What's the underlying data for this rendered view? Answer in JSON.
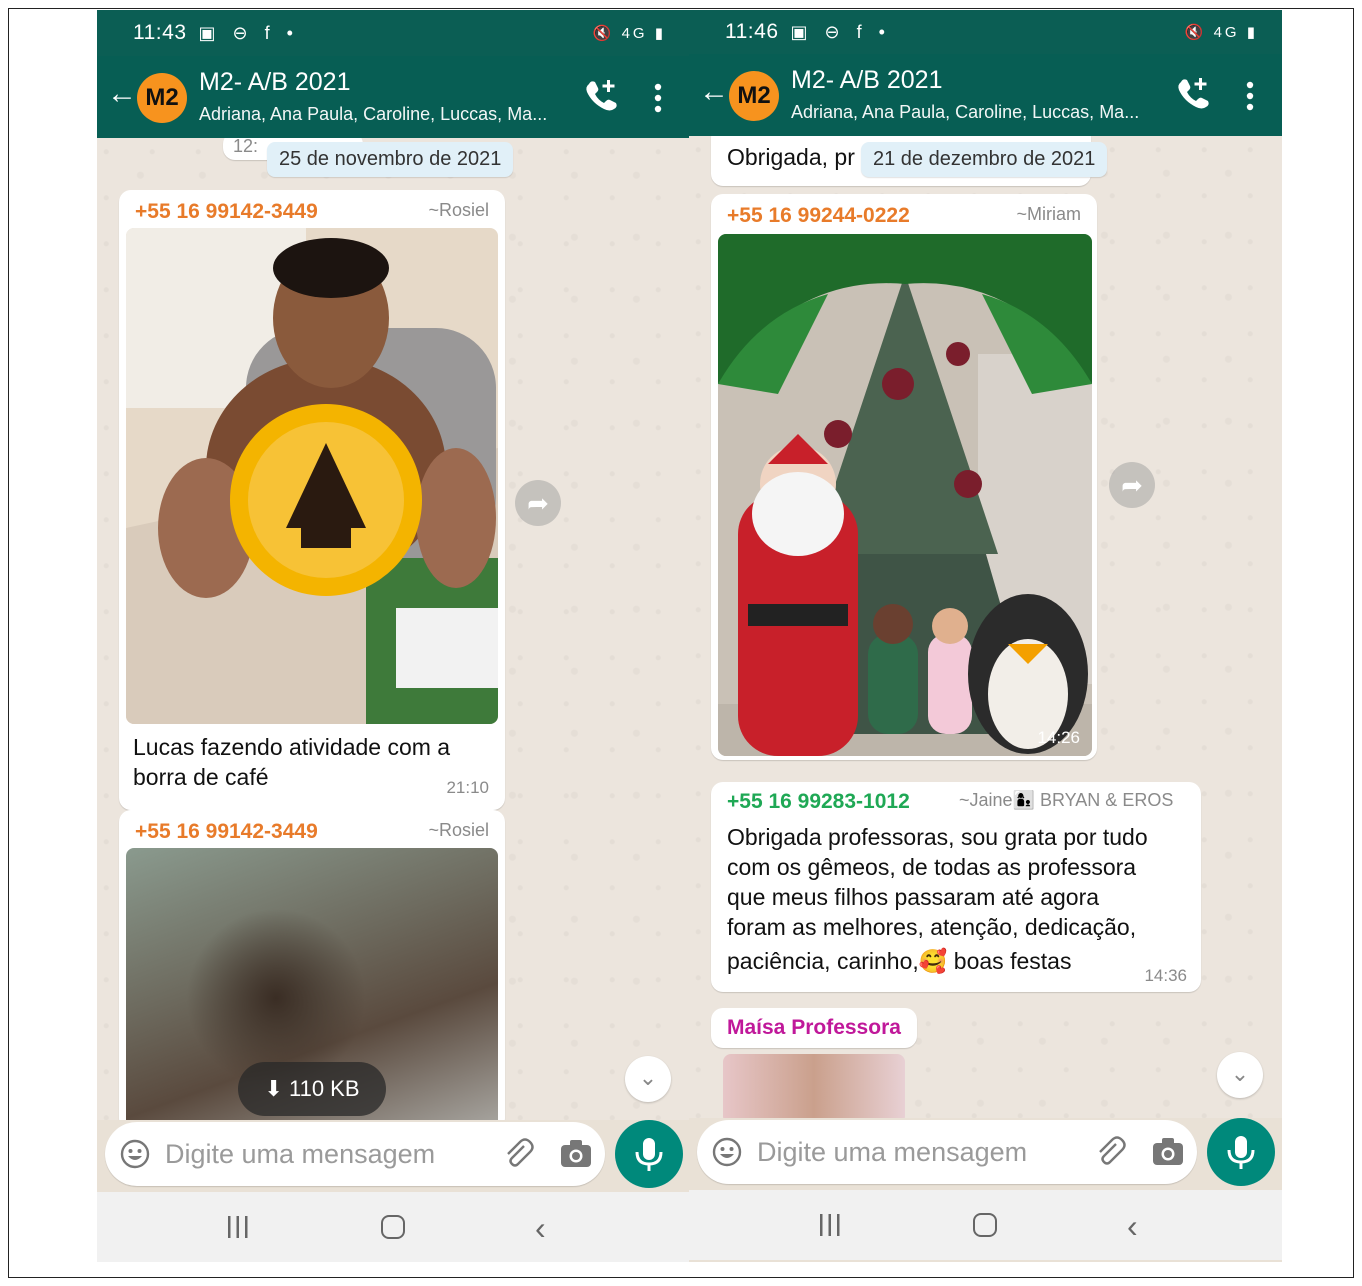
{
  "left": {
    "status": {
      "time": "11:43",
      "icons": "▣ ⊖ f •",
      "right_icons": "🔇 4G ▮"
    },
    "header": {
      "avatar_text": "M2",
      "title": "M2- A/B 2021",
      "subtitle": "Adriana, Ana Paula, Caroline, Luccas, Ma..."
    },
    "partial_time": "12:",
    "date_chip": "25 de novembro de 2021",
    "messages": [
      {
        "phone": "+55 16 99142-3449",
        "name": "~Rosiel",
        "text_line1": "Lucas fazendo atividade com a",
        "text_line2": "borra de café",
        "time": "21:10"
      },
      {
        "phone": "+55 16 99142-3449",
        "name": "~Rosiel",
        "download": "110 KB"
      }
    ],
    "composer": {
      "placeholder": "Digite uma mensagem"
    }
  },
  "right": {
    "status": {
      "time": "11:46",
      "icons": "▣ ⊖ f •",
      "right_icons": "🔇 4G ▮"
    },
    "header": {
      "avatar_text": "M2",
      "title": "M2- A/B 2021",
      "subtitle": "Adriana, Ana Paula, Caroline, Luccas, Ma..."
    },
    "partial_text": "Obrigada, pr",
    "date_chip": "21 de dezembro de 2021",
    "messages": [
      {
        "phone": "+55 16 99244-0222",
        "name": "~Miriam",
        "photo_time": "14:26"
      },
      {
        "phone": "+55 16 99283-1012",
        "name": "~Jaine👩‍👦 BRYAN & EROS",
        "lines": [
          "Obrigada professoras, sou grata por tudo",
          "com os gêmeos, de todas as professora",
          "que meus filhos passaram até agora",
          "foram as melhores, atenção, dedicação,",
          "paciência, carinho,🥰 boas festas"
        ],
        "time": "14:36"
      },
      {
        "sender": "Maísa Professora"
      }
    ],
    "composer": {
      "placeholder": "Digite uma mensagem"
    }
  },
  "colors": {
    "header": "#075e54",
    "status": "#0b5e54",
    "accent": "#00897b",
    "orange_sender": "#e87b2a",
    "green_sender": "#1fa855",
    "magenta_sender": "#c0189a"
  }
}
